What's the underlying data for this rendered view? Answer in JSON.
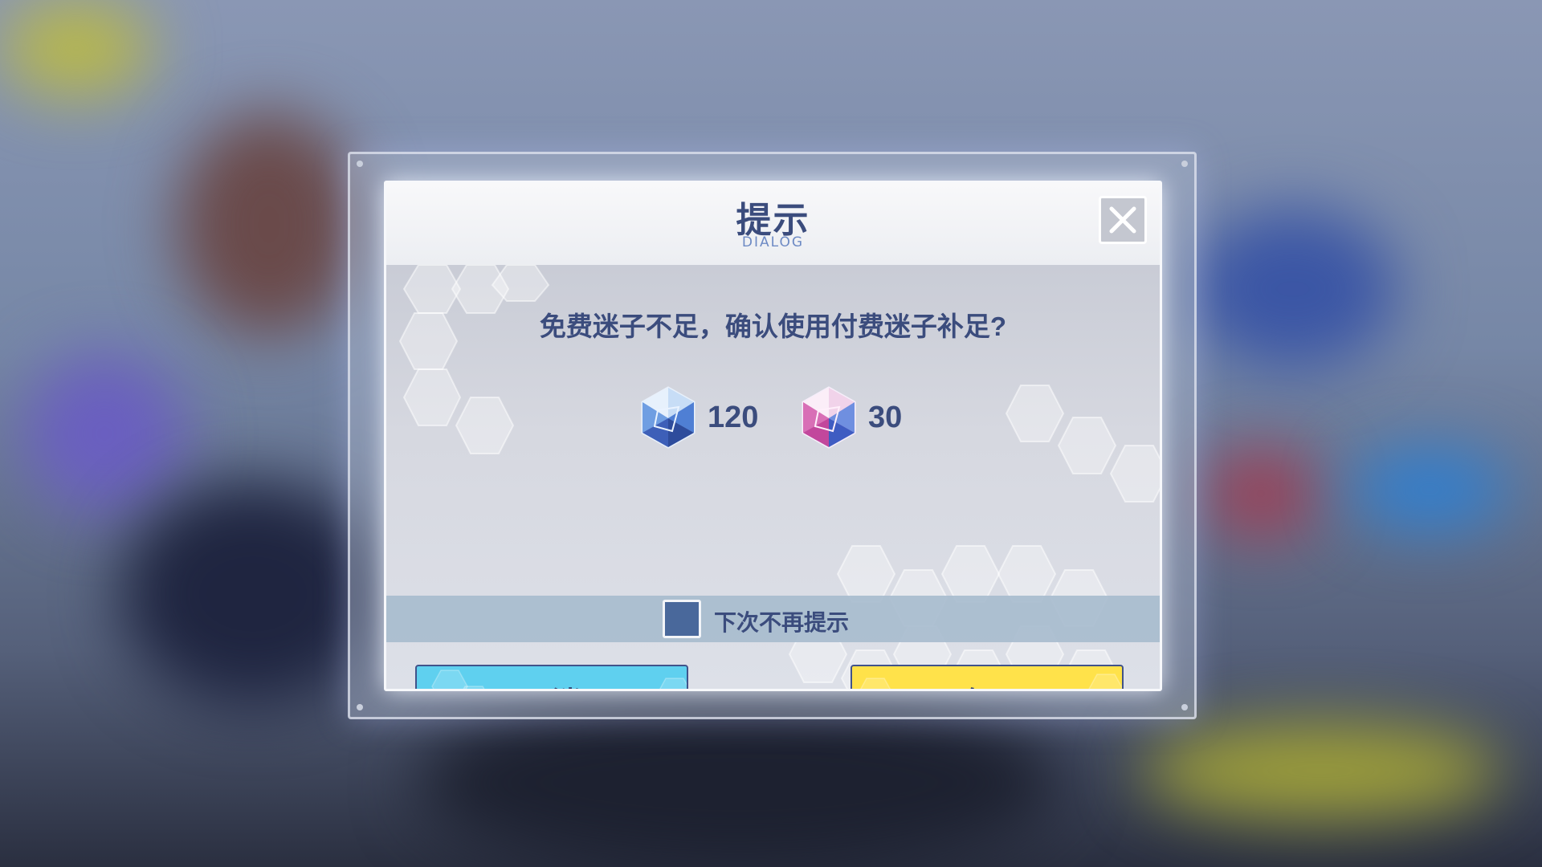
{
  "dialog": {
    "title": "提示",
    "subtitle": "DIALOG",
    "message": "免费迷子不足，确认使用付费迷子补足?",
    "costs": [
      {
        "icon": "blue-crystal-icon",
        "value": "120"
      },
      {
        "icon": "pink-crystal-icon",
        "value": "30"
      }
    ],
    "dont_remind_label": "下次不再提示",
    "cancel_label": "取消",
    "buy_label": "购买"
  },
  "colors": {
    "text": "#3b4c7d",
    "cancel_button": "#5fd0ef",
    "buy_button": "#ffe24a",
    "checkbox": "#49689b"
  }
}
